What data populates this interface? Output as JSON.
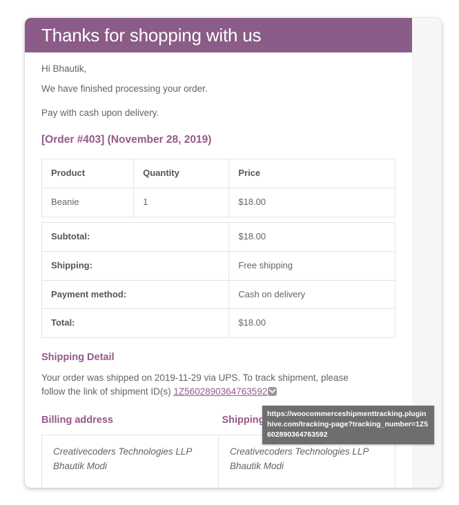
{
  "email": {
    "header_title": "Thanks for shopping with us",
    "greeting": "Hi Bhautik,",
    "processing_note": "We have finished processing your order.",
    "payment_note": "Pay with cash upon delivery.",
    "order_heading": "[Order #403] (November 28, 2019)"
  },
  "order_table": {
    "columns": [
      "Product",
      "Quantity",
      "Price"
    ],
    "rows": [
      {
        "product": "Beanie",
        "quantity": "1",
        "price": "$18.00"
      }
    ],
    "totals": [
      {
        "label": "Subtotal:",
        "value": "$18.00"
      },
      {
        "label": "Shipping:",
        "value": "Free shipping"
      },
      {
        "label": "Payment method:",
        "value": "Cash on delivery"
      },
      {
        "label": "Total:",
        "value": "$18.00"
      }
    ]
  },
  "shipping_detail": {
    "heading": "Shipping Detail",
    "text_before": "Your order was shipped on 2019-11-29 via UPS. To track shipment, please follow the link of shipment ID(s) ",
    "tracking_number": "1Z5602890364763592",
    "dropdown_icon": "chevron-down-icon"
  },
  "addresses": {
    "billing_heading": "Billing address",
    "shipping_heading": "Shipping address",
    "billing": {
      "line1": "Creativecoders Technologies LLP",
      "line2": "Bhautik Modi"
    },
    "shipping": {
      "line1": "Creativecoders Technologies LLP",
      "line2": "Bhautik Modi"
    }
  },
  "tooltip": {
    "url": "https://woocommerceshipmenttracking.pluginhive.com/tracking-page?tracking_number=1Z5602890364763592"
  },
  "colors": {
    "header_purple": "#8a5c87",
    "heading_purple": "#96588a",
    "body_text": "#636363",
    "border": "#e4e4e4",
    "tooltip_bg": "#6e6e6e",
    "card_outer": "#f6f6f6"
  }
}
